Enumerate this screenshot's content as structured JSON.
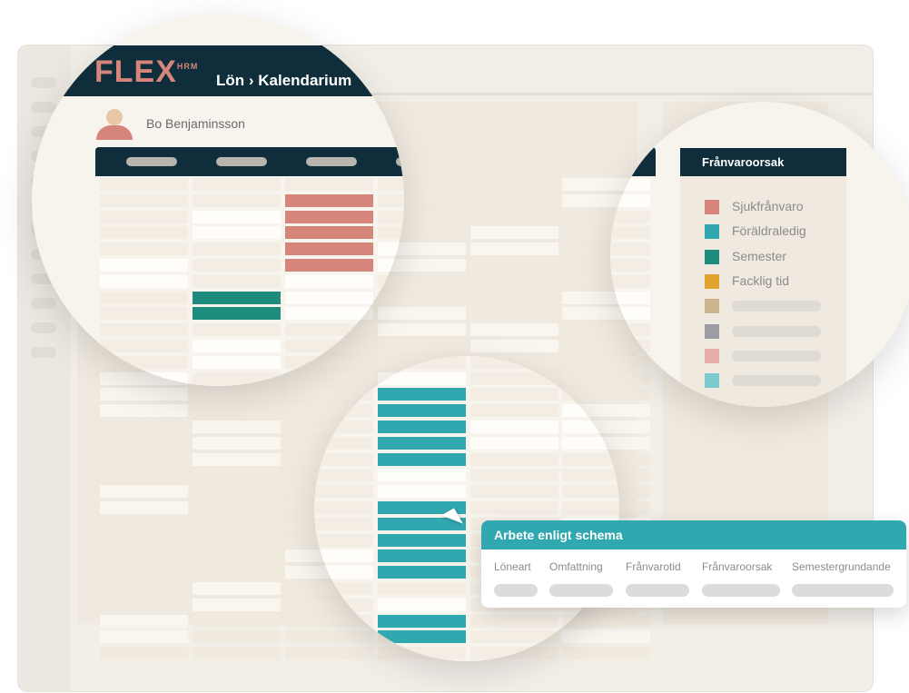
{
  "brand": {
    "logo_text": "FLEX",
    "logo_sup": "HRM",
    "breadcrumb": "Lön › Kalendarium"
  },
  "user": {
    "name": "Bo Benjaminsson"
  },
  "legend": {
    "title": "Frånvaroorsak",
    "items": [
      {
        "label": "Sjukfrånvaro",
        "color": "#d6857b"
      },
      {
        "label": "Föräldraledig",
        "color": "#31a8b0"
      },
      {
        "label": "Semester",
        "color": "#1e8c7d"
      },
      {
        "label": "Facklig tid",
        "color": "#e0a52d"
      },
      {
        "label": "",
        "color": "#cdb48d"
      },
      {
        "label": "",
        "color": "#9b9da3"
      },
      {
        "label": "",
        "color": "#e6aea8"
      },
      {
        "label": "",
        "color": "#7fcace"
      }
    ]
  },
  "tooltip": {
    "title": "Arbete enligt schema",
    "columns": [
      "Löneart",
      "Omfattning",
      "Frånvarotid",
      "Frånvaroorsak",
      "Semestergrundande"
    ]
  },
  "colors": {
    "navy": "#0f2d3b",
    "logo": "#d6857b",
    "sick": "#d6857b",
    "parental": "#31a8b0",
    "vacation": "#1e8c7d"
  }
}
